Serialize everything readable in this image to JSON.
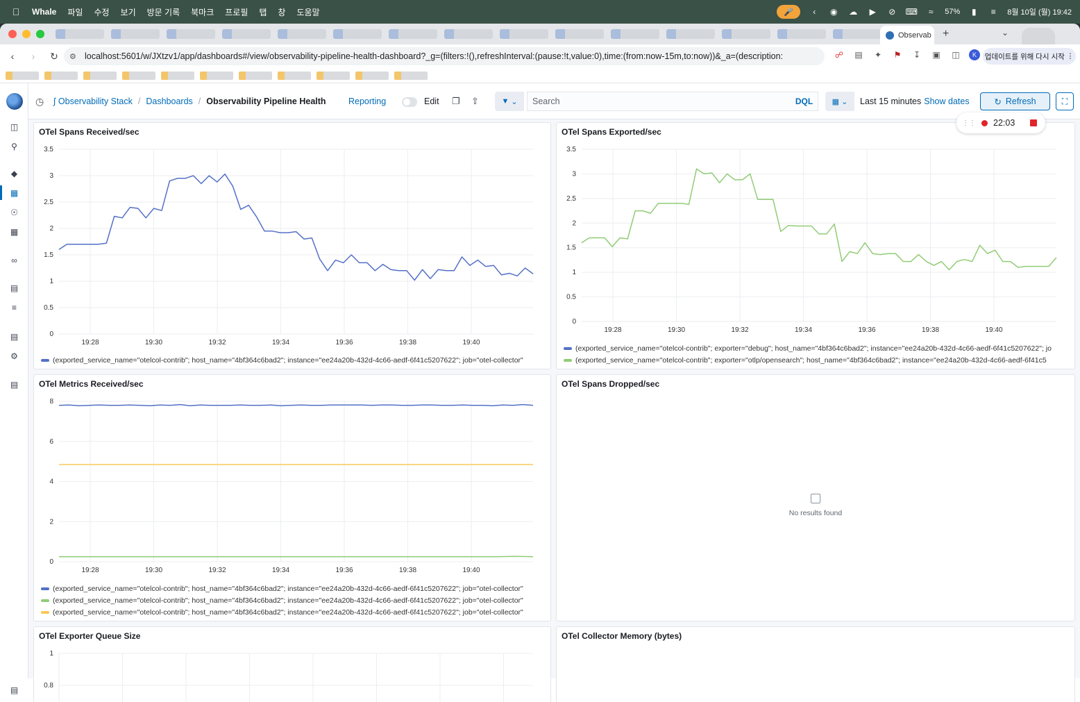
{
  "menubar": {
    "app": "Whale",
    "items": [
      "파일",
      "수정",
      "보기",
      "방문 기록",
      "북마크",
      "프로필",
      "탭",
      "창",
      "도움말"
    ],
    "battery": "57%",
    "datetime": "8월 10일 (월) 19:42"
  },
  "browser": {
    "active_tab": "Observab",
    "url": "localhost:5601/w/JXtzv1/app/dashboards#/view/observability-pipeline-health-dashboard?_g=(filters:!(),refreshInterval:(pause:!t,value:0),time:(from:now-15m,to:now))&_a=(description:",
    "update_button": "업데이트를 위해 다시 시작",
    "avatar_letter": "K"
  },
  "header": {
    "breadcrumbs": [
      "Observability Stack",
      "Dashboards",
      "Observability Pipeline Health"
    ],
    "reporting": "Reporting",
    "edit": "Edit",
    "search_placeholder": "Search",
    "dql": "DQL",
    "time_label": "Last 15 minutes",
    "show_dates": "Show dates",
    "refresh": "Refresh"
  },
  "recorder": {
    "time": "22:03"
  },
  "colors": {
    "blue": "#5470c6",
    "green": "#91cc75",
    "yellow": "#fac858",
    "accent": "#006bb8"
  },
  "panels": {
    "spans_received": {
      "title": "OTel Spans Received/sec",
      "legend": [
        "(exported_service_name=\"otelcol-contrib\"; host_name=\"4bf364c6bad2\"; instance=\"ee24a20b-432d-4c66-aedf-6f41c5207622\"; job=\"otel-collector\""
      ]
    },
    "spans_exported": {
      "title": "OTel Spans Exported/sec",
      "legend": [
        "(exported_service_name=\"otelcol-contrib\"; exporter=\"debug\"; host_name=\"4bf364c6bad2\"; instance=\"ee24a20b-432d-4c66-aedf-6f41c5207622\"; jo",
        "(exported_service_name=\"otelcol-contrib\"; exporter=\"otlp/opensearch\"; host_name=\"4bf364c6bad2\"; instance=\"ee24a20b-432d-4c66-aedf-6f41c5"
      ]
    },
    "metrics_received": {
      "title": "OTel Metrics Received/sec",
      "legend": [
        "(exported_service_name=\"otelcol-contrib\"; host_name=\"4bf364c6bad2\"; instance=\"ee24a20b-432d-4c66-aedf-6f41c5207622\"; job=\"otel-collector\"",
        "(exported_service_name=\"otelcol-contrib\"; host_name=\"4bf364c6bad2\"; instance=\"ee24a20b-432d-4c66-aedf-6f41c5207622\"; job=\"otel-collector\"",
        "(exported_service_name=\"otelcol-contrib\"; host_name=\"4bf364c6bad2\"; instance=\"ee24a20b-432d-4c66-aedf-6f41c5207622\"; job=\"otel-collector\""
      ]
    },
    "spans_dropped": {
      "title": "OTel Spans Dropped/sec",
      "empty_text": "No results found"
    },
    "queue_size": {
      "title": "OTel Exporter Queue Size"
    },
    "collector_memory": {
      "title": "OTel Collector Memory (bytes)"
    }
  },
  "chart_data": [
    {
      "type": "line",
      "title": "OTel Spans Received/sec",
      "x_ticks": [
        "19:28",
        "19:30",
        "19:32",
        "19:34",
        "19:36",
        "19:38",
        "19:40"
      ],
      "ylim": [
        0,
        3.5
      ],
      "y_ticks": [
        0,
        0.5,
        1,
        1.5,
        2,
        2.5,
        3,
        3.5
      ],
      "grid": true,
      "legend_position": "bottom",
      "series": [
        {
          "color": "#5470c6",
          "values": [
            1.6,
            1.7,
            1.7,
            1.7,
            1.7,
            1.7,
            1.72,
            2.23,
            2.2,
            2.4,
            2.38,
            2.2,
            2.38,
            2.34,
            2.9,
            2.95,
            2.95,
            3.0,
            2.85,
            3.0,
            2.88,
            3.03,
            2.8,
            2.36,
            2.44,
            2.22,
            1.95,
            1.95,
            1.92,
            1.92,
            1.94,
            1.8,
            1.82,
            1.42,
            1.2,
            1.4,
            1.35,
            1.5,
            1.35,
            1.35,
            1.2,
            1.32,
            1.22,
            1.2,
            1.2,
            1.02,
            1.22,
            1.05,
            1.22,
            1.2,
            1.2,
            1.46,
            1.3,
            1.4,
            1.28,
            1.3,
            1.12,
            1.15,
            1.1,
            1.25,
            1.14
          ]
        }
      ]
    },
    {
      "type": "line",
      "title": "OTel Spans Exported/sec",
      "x_ticks": [
        "19:28",
        "19:30",
        "19:32",
        "19:34",
        "19:36",
        "19:38",
        "19:40"
      ],
      "ylim": [
        0,
        3.5
      ],
      "y_ticks": [
        0,
        0.5,
        1,
        1.5,
        2,
        2.5,
        3,
        3.5
      ],
      "grid": true,
      "legend_position": "bottom",
      "series": [
        {
          "color": "#91cc75",
          "values": [
            1.6,
            1.7,
            1.7,
            1.7,
            1.52,
            1.7,
            1.68,
            2.25,
            2.25,
            2.2,
            2.4,
            2.4,
            2.4,
            2.4,
            2.38,
            3.1,
            3.0,
            3.02,
            2.82,
            3.0,
            2.88,
            2.88,
            3.0,
            2.48,
            2.48,
            2.48,
            1.83,
            1.95,
            1.94,
            1.94,
            1.94,
            1.78,
            1.78,
            1.98,
            1.22,
            1.42,
            1.38,
            1.6,
            1.38,
            1.36,
            1.38,
            1.38,
            1.22,
            1.22,
            1.36,
            1.22,
            1.14,
            1.22,
            1.05,
            1.22,
            1.26,
            1.22,
            1.55,
            1.38,
            1.45,
            1.22,
            1.22,
            1.1,
            1.12,
            1.12,
            1.12,
            1.12,
            1.3
          ]
        }
      ]
    },
    {
      "type": "line",
      "title": "OTel Metrics Received/sec",
      "x_ticks": [
        "19:28",
        "19:30",
        "19:32",
        "19:34",
        "19:36",
        "19:38",
        "19:40"
      ],
      "ylim": [
        0,
        8
      ],
      "y_ticks": [
        0,
        2,
        4,
        6,
        8
      ],
      "grid": true,
      "legend_position": "bottom",
      "series": [
        {
          "color": "#5470c6",
          "values": [
            7.8,
            7.82,
            7.78,
            7.8,
            7.82,
            7.8,
            7.8,
            7.82,
            7.8,
            7.78,
            7.82,
            7.8,
            7.84,
            7.78,
            7.82,
            7.8,
            7.8,
            7.8,
            7.82,
            7.8,
            7.8,
            7.82,
            7.78,
            7.8,
            7.82,
            7.8,
            7.8,
            7.82,
            7.82,
            7.82,
            7.82,
            7.8,
            7.82,
            7.82,
            7.8,
            7.8,
            7.82,
            7.82,
            7.8,
            7.8,
            7.82,
            7.8,
            7.8,
            7.78,
            7.82,
            7.8,
            7.84,
            7.8
          ]
        },
        {
          "color": "#91cc75",
          "values": [
            0.25,
            0.25,
            0.25,
            0.25,
            0.25,
            0.25,
            0.25,
            0.25,
            0.25,
            0.25,
            0.25,
            0.25,
            0.25,
            0.25,
            0.25,
            0.25,
            0.25,
            0.25,
            0.25,
            0.25,
            0.25,
            0.25,
            0.25,
            0.25,
            0.25,
            0.27,
            0.25
          ]
        },
        {
          "color": "#fac858",
          "values": [
            4.85,
            4.85,
            4.85,
            4.85,
            4.85,
            4.85,
            4.85,
            4.85,
            4.85,
            4.85,
            4.85,
            4.85,
            4.85,
            4.85,
            4.85,
            4.85,
            4.85,
            4.85,
            4.85,
            4.85,
            4.85,
            4.85,
            4.85,
            4.85,
            4.85,
            4.85,
            4.85
          ]
        }
      ]
    },
    {
      "type": "line",
      "title": "OTel Exporter Queue Size",
      "y_ticks": [
        0.8,
        1
      ],
      "grid": true,
      "series": []
    }
  ]
}
